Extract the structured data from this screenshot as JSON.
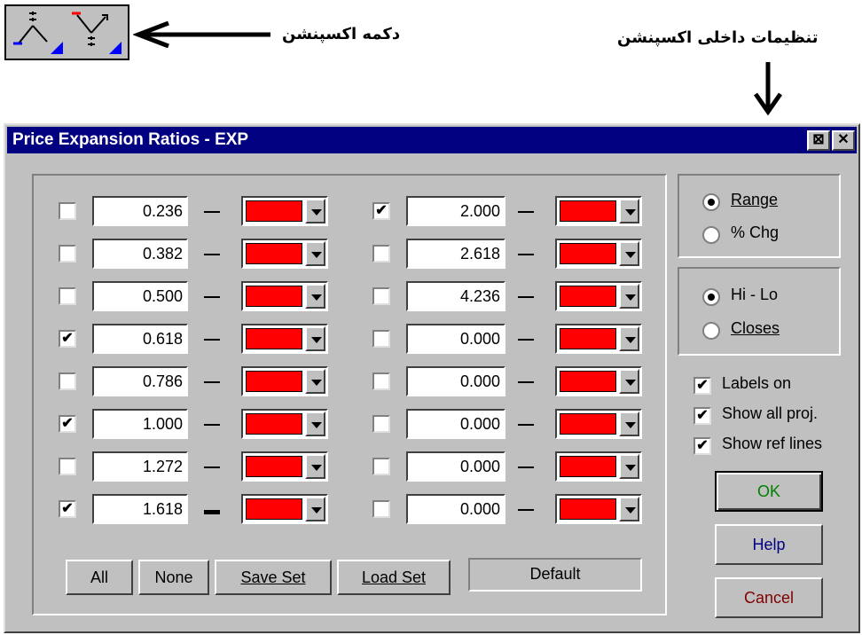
{
  "annotations": {
    "expansion_button": "دکمه اکسپنشن",
    "expansion_settings": "تنظیمات داخلی اکسپنشن"
  },
  "colors": {
    "swatch": "#ff0000",
    "title_bg": "#000080",
    "ok_text": "#008000",
    "help_text": "#000080",
    "cancel_text": "#800000"
  },
  "dialog": {
    "title": "Price Expansion Ratios - EXP",
    "titlebar_buttons": [
      "pin-icon",
      "close-icon"
    ],
    "left_column": [
      {
        "checked": false,
        "value": "0.236"
      },
      {
        "checked": false,
        "value": "0.382"
      },
      {
        "checked": false,
        "value": "0.500"
      },
      {
        "checked": true,
        "value": "0.618"
      },
      {
        "checked": false,
        "value": "0.786"
      },
      {
        "checked": true,
        "value": "1.000"
      },
      {
        "checked": false,
        "value": "1.272"
      },
      {
        "checked": true,
        "value": "1.618"
      }
    ],
    "right_column": [
      {
        "checked": true,
        "value": "2.000"
      },
      {
        "checked": false,
        "value": "2.618"
      },
      {
        "checked": false,
        "value": "4.236"
      },
      {
        "checked": false,
        "value": "0.000"
      },
      {
        "checked": false,
        "value": "0.000"
      },
      {
        "checked": false,
        "value": "0.000"
      },
      {
        "checked": false,
        "value": "0.000"
      },
      {
        "checked": false,
        "value": "0.000"
      }
    ],
    "buttons": {
      "all": "All",
      "none": "None",
      "save_set": "Save Set",
      "load_set": "Load Set"
    },
    "default_label": "Default",
    "range_group": {
      "range": "Range",
      "pct_chg": "% Chg",
      "selected": "range"
    },
    "hilo_group": {
      "hilo": "Hi - Lo",
      "closes": "Closes",
      "selected": "hilo"
    },
    "options": [
      {
        "label": "Labels on",
        "checked": true
      },
      {
        "label": "Show all proj.",
        "checked": true
      },
      {
        "label": "Show ref lines",
        "checked": true
      }
    ],
    "ok": "OK",
    "help": "Help",
    "cancel": "Cancel"
  }
}
